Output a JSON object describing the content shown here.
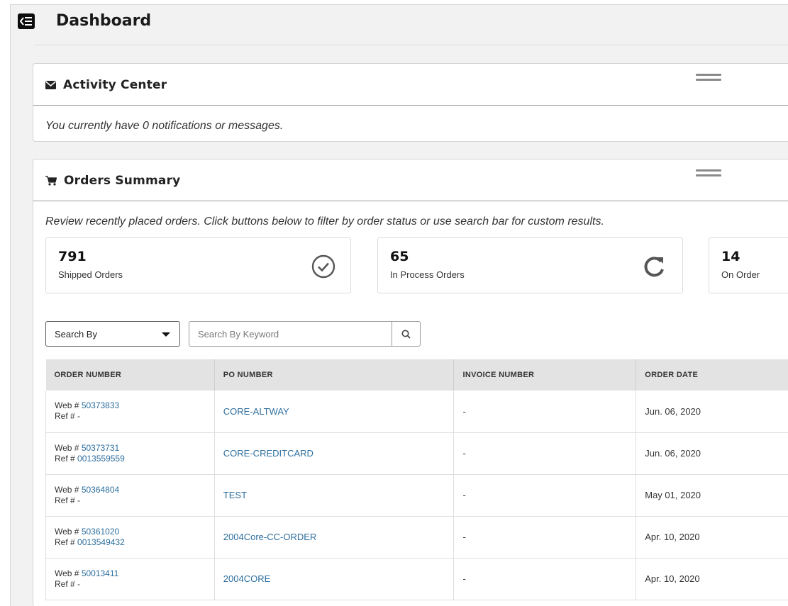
{
  "header": {
    "title": "Dashboard"
  },
  "activity": {
    "title": "Activity Center",
    "message": "You currently have 0 notifications or messages."
  },
  "orders": {
    "title": "Orders Summary",
    "description": "Review recently placed orders. Click buttons below to filter by order status or use search bar for custom results.",
    "stats": [
      {
        "count": "791",
        "label": "Shipped Orders",
        "icon": "check-circle-icon"
      },
      {
        "count": "65",
        "label": "In Process Orders",
        "icon": "refresh-icon"
      },
      {
        "count": "14",
        "label": "On Order"
      }
    ],
    "search": {
      "search_by_label": "Search By",
      "keyword_placeholder": "Search By Keyword"
    },
    "table": {
      "columns": [
        "ORDER NUMBER",
        "PO NUMBER",
        "INVOICE NUMBER",
        "ORDER DATE"
      ],
      "web_prefix": "Web #",
      "ref_prefix": "Ref #",
      "rows": [
        {
          "web": "50373833",
          "ref": "-",
          "po": "CORE-ALTWAY",
          "invoice": "-",
          "date": "Jun. 06, 2020"
        },
        {
          "web": "50373731",
          "ref": "0013559559",
          "po": "CORE-CREDITCARD",
          "invoice": "-",
          "date": "Jun. 06, 2020"
        },
        {
          "web": "50364804",
          "ref": "-",
          "po": "TEST",
          "invoice": "-",
          "date": "May 01, 2020"
        },
        {
          "web": "50361020",
          "ref": "0013549432",
          "po": "2004Core-CC-ORDER",
          "invoice": "-",
          "date": "Apr. 10, 2020"
        },
        {
          "web": "50013411",
          "ref": "-",
          "po": "2004CORE",
          "invoice": "-",
          "date": "Apr. 10, 2020"
        }
      ]
    }
  },
  "colors": {
    "link": "#2d6e9e",
    "background": "#f2f2f2",
    "table_header": "#e3e3e3"
  }
}
